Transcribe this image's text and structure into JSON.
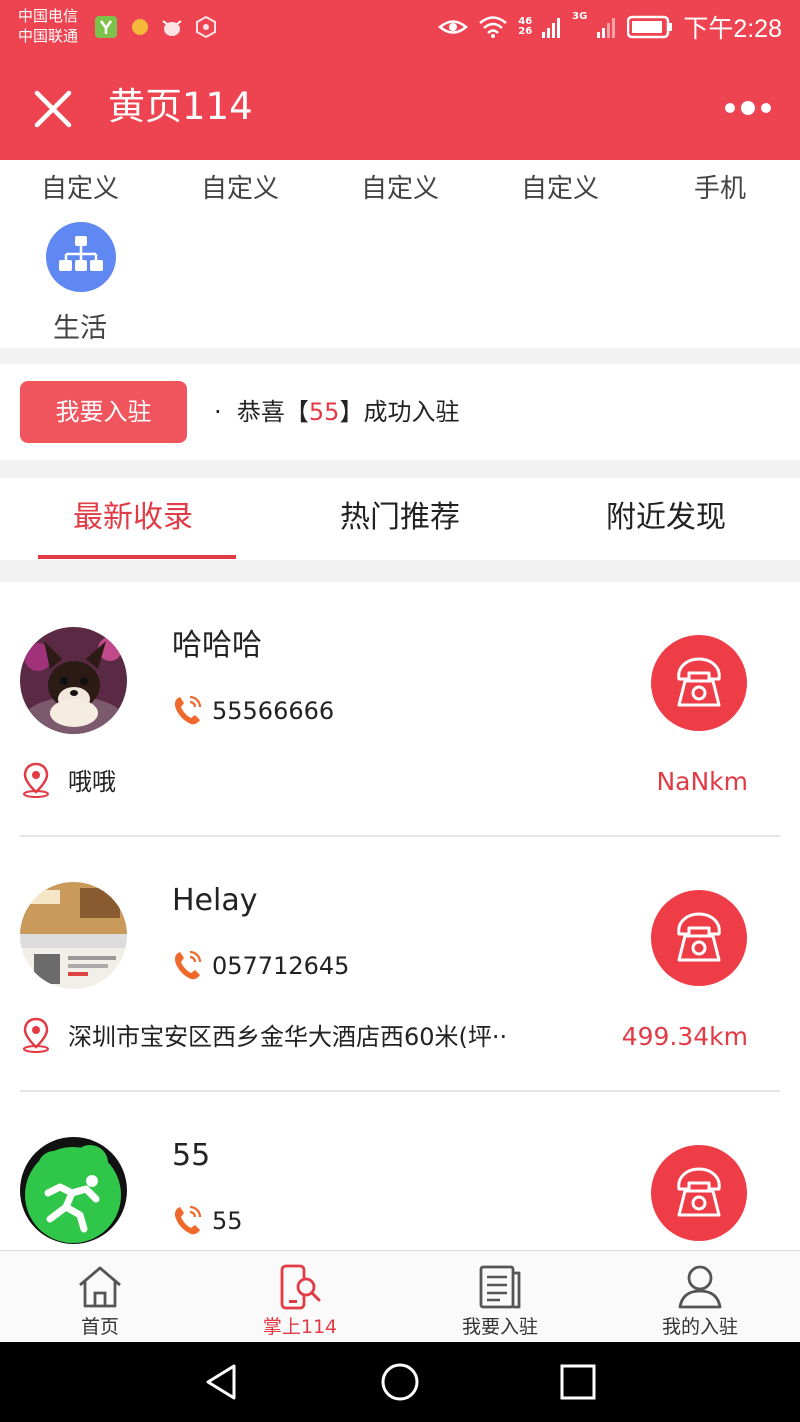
{
  "status_bar": {
    "carrier_1": "中国电信",
    "carrier_2": "中国联通",
    "network_1": "46",
    "network_2": "26",
    "network_3": "3G",
    "time": "下午2:28"
  },
  "header": {
    "title": "黄页114",
    "close_icon": "close-icon",
    "more_icon": "more-dots-icon"
  },
  "categories": {
    "items": [
      "自定义",
      "自定义",
      "自定义",
      "自定义",
      "手机"
    ],
    "life_label": "生活",
    "life_icon": "org-chart-icon"
  },
  "join_bar": {
    "button_label": "我要入驻",
    "news_dot": "·",
    "news_prefix": "恭喜【",
    "news_number": "55",
    "news_suffix": "】成功入驻"
  },
  "tabs": [
    {
      "label": "最新收录",
      "active": true
    },
    {
      "label": "热门推荐",
      "active": false
    },
    {
      "label": "附近发现",
      "active": false
    }
  ],
  "listings": [
    {
      "name": "哈哈哈",
      "phone": "55566666",
      "address": "哦哦",
      "distance": "NaNkm"
    },
    {
      "name": "Helay",
      "phone": "057712645",
      "address": "深圳市宝安区西乡金华大酒店西60米(坪··",
      "distance": "499.34km"
    },
    {
      "name": "55",
      "phone": "55",
      "address": "",
      "distance": ""
    }
  ],
  "bottom_nav": [
    {
      "label": "首页",
      "icon": "home-icon",
      "active": false
    },
    {
      "label": "掌上114",
      "icon": "phone-search-icon",
      "active": true
    },
    {
      "label": "我要入驻",
      "icon": "document-icon",
      "active": false
    },
    {
      "label": "我的入驻",
      "icon": "user-icon",
      "active": false
    }
  ],
  "colors": {
    "brand_red": "#ee4350",
    "accent_red": "#e23b46",
    "category_blue": "#5f88f2"
  }
}
